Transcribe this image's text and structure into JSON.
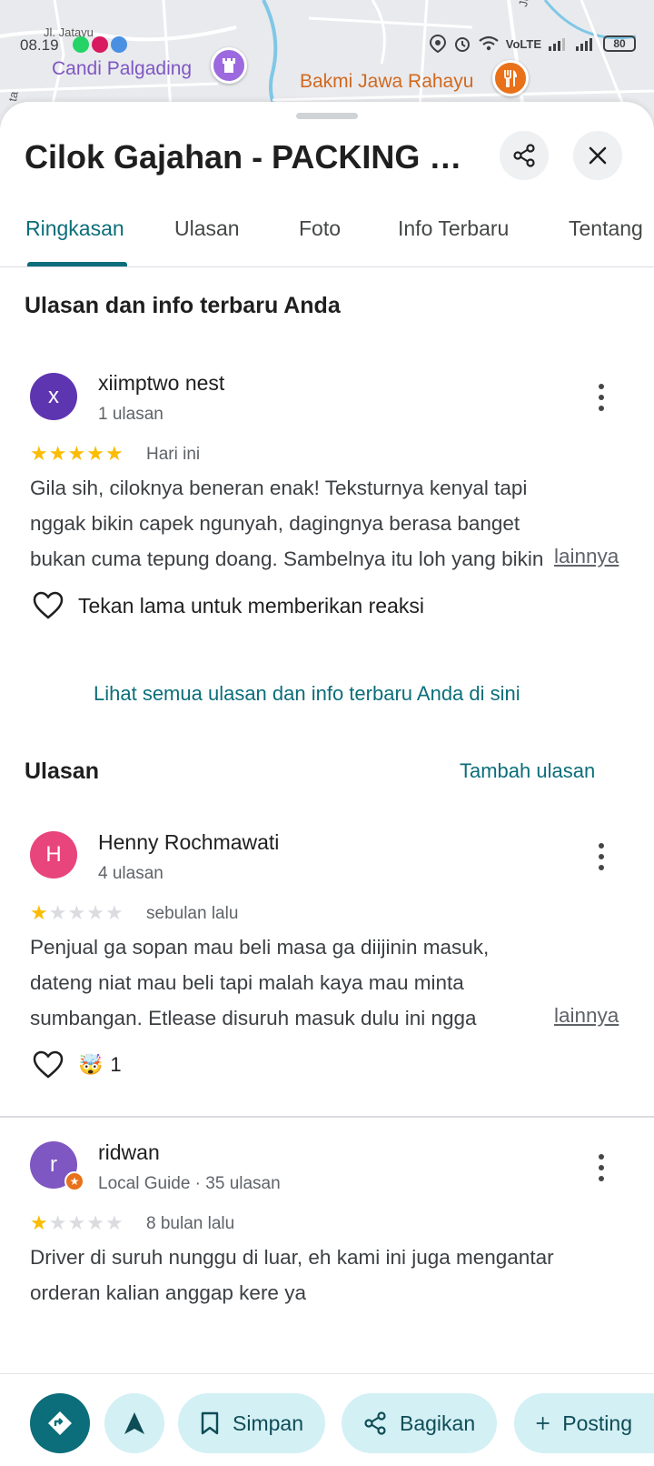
{
  "status_bar": {
    "time": "08.19",
    "network": "VoLTE",
    "battery": "80",
    "app_icons": [
      "whatsapp-icon",
      "app-icon",
      "cloud-icon"
    ]
  },
  "map": {
    "street_top": "Jl. Jatayu",
    "street_right": "Jl. Te",
    "street_left": "ta",
    "places": [
      {
        "name": "Candi Palgading",
        "icon": "castle-icon",
        "color": "#9c6ade"
      },
      {
        "name": "Bakmi Jawa Rahayu",
        "icon": "restaurant-icon",
        "color": "#e8711a"
      }
    ]
  },
  "place": {
    "title": "Cilok Gajahan - PACKING H..."
  },
  "tabs": [
    {
      "label": "Ringkasan",
      "active": true
    },
    {
      "label": "Ulasan",
      "active": false
    },
    {
      "label": "Foto",
      "active": false
    },
    {
      "label": "Info Terbaru",
      "active": false
    },
    {
      "label": "Tentang",
      "active": false
    }
  ],
  "my_review": {
    "section_title": "Ulasan dan info terbaru Anda",
    "author": "xiimptwo nest",
    "avatar_letter": "x",
    "avatar_color": "#5e35b1",
    "meta": "1 ulasan",
    "rating": 5,
    "date": "Hari ini",
    "text": "Gila sih, ciloknya beneran enak! Teksturnya kenyal tapi nggak bikin capek ngunyah, dagingnya berasa banget bukan cuma tepung doang. Sambelnya itu loh yang bikin ...",
    "more": "lainnya",
    "react_hint": "Tekan lama untuk memberikan reaksi",
    "see_all": "Lihat semua ulasan dan info terbaru Anda di sini"
  },
  "reviews_section": {
    "title": "Ulasan",
    "add_review": "Tambah ulasan"
  },
  "reviews": [
    {
      "author": "Henny Rochmawati",
      "avatar_letter": "H",
      "avatar_color": "#e8457c",
      "meta": "4 ulasan",
      "rating": 1,
      "date": "sebulan lalu",
      "text": "Penjual ga sopan mau beli masa ga diijinin masuk, dateng niat mau beli tapi malah kaya mau minta sumbangan. Etlease disuruh masuk dulu ini ngga akunya masih ...",
      "more": "lainnya",
      "reaction_emoji": "🤯",
      "reaction_count": "1"
    },
    {
      "author": "ridwan",
      "avatar_letter": "r",
      "avatar_color": "#7e57c2",
      "meta": "Local Guide · 35 ulasan",
      "rating": 1,
      "date": "8 bulan lalu",
      "text": "Driver di suruh nunggu di luar, eh kami ini juga mengantar orderan kalian anggap kere ya"
    }
  ],
  "bottom_bar": {
    "save": "Simpan",
    "share": "Bagikan",
    "post": "Posting"
  },
  "colors": {
    "accent": "#0b6e7a",
    "star": "#fbbc04",
    "pill_bg": "#d3f0f5"
  }
}
